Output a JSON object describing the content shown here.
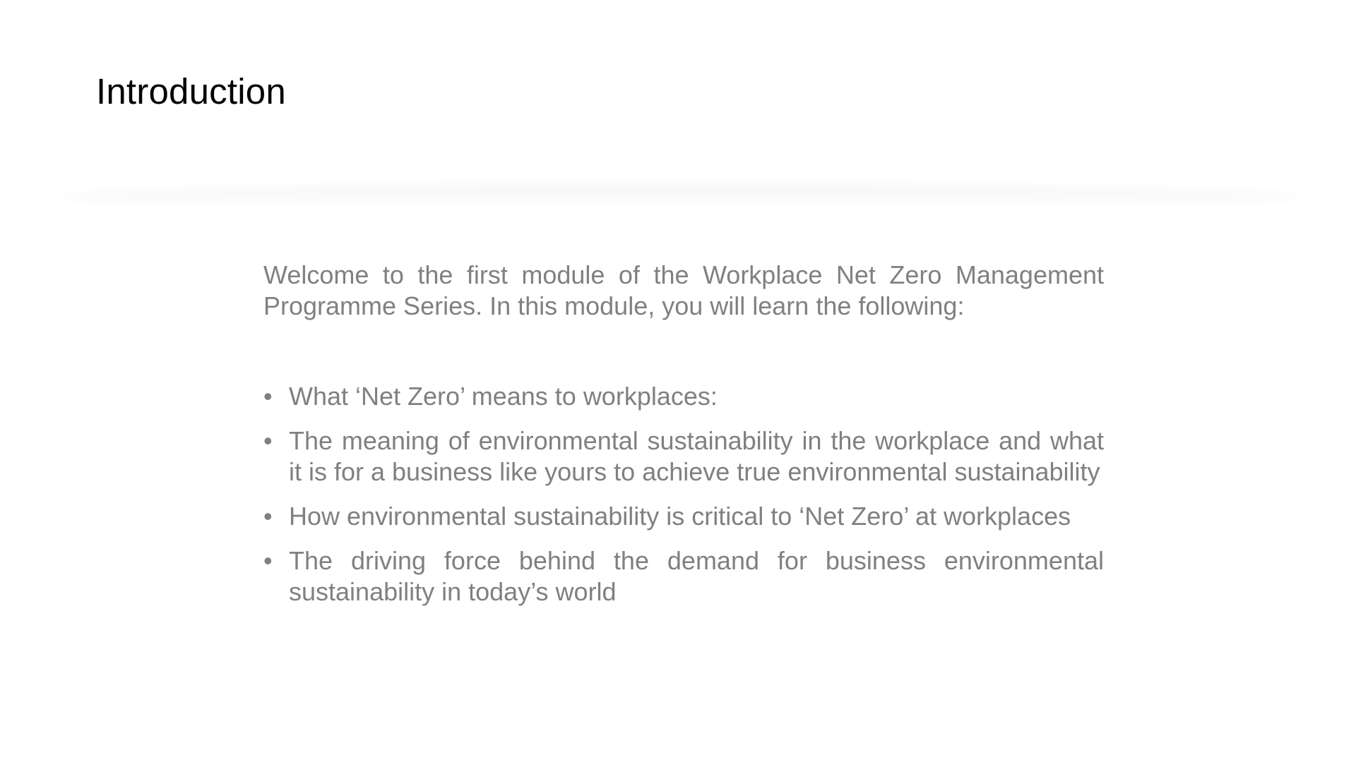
{
  "slide": {
    "title": "Introduction",
    "intro": "Welcome to the first module of the Workplace Net Zero Management Programme Series. In this module, you will learn the following:",
    "bullet_glyph": "•",
    "bullets": [
      "What ‘Net Zero’ means to workplaces:",
      "The meaning of environmental sustainability in the workplace and what it is for a business like yours to achieve true environmental sustainability",
      "How environmental sustainability is critical to ‘Net Zero’ at workplaces",
      "The driving force behind the demand for business environmental sustainability in today’s world"
    ]
  },
  "colors": {
    "title": "#000000",
    "body_text": "#808080",
    "background": "#ffffff"
  }
}
